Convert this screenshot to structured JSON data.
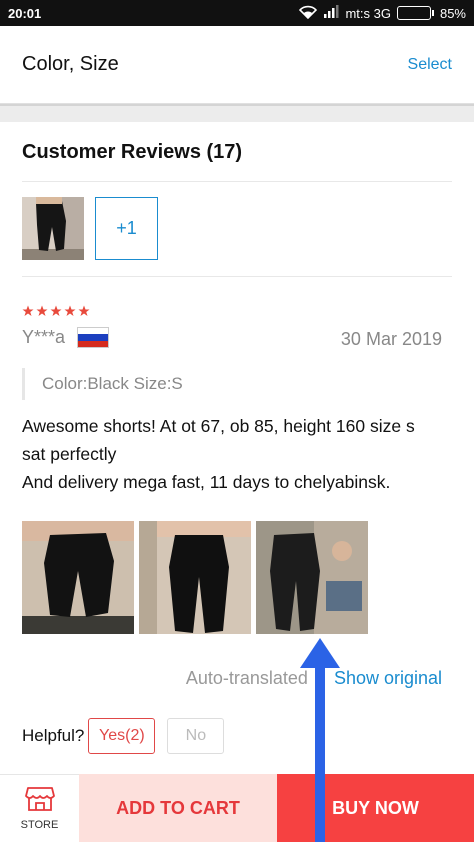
{
  "status_bar": {
    "time": "20:01",
    "carrier": "mt:s 3G",
    "battery": "85%",
    "battery_level": 0.85
  },
  "variant_row": {
    "label": "Color, Size",
    "action": "Select"
  },
  "reviews": {
    "title": "Customer Reviews (17)",
    "more_photos": "+1",
    "review": {
      "rating": 5,
      "reviewer": "Y***a",
      "country_flag": "flag-russia-icon",
      "date": "30 Mar 2019",
      "attributes": "Color:Black Size:S",
      "text_line1": "Awesome shorts! At ot 67, ob 85, height 160 size s",
      "text_line2": "sat perfectly",
      "text_line3": "And delivery mega fast, 11 days to chelyabinsk.",
      "auto_translated": "Auto-translated",
      "show_original": "Show original",
      "helpful_label": "Helpful?",
      "yes_label": "Yes(2)",
      "no_label": "No"
    }
  },
  "bottom_bar": {
    "store_label": "STORE",
    "add_to_cart": "ADD TO CART",
    "buy_now": "BUY NOW"
  },
  "colors": {
    "accent_blue": "#1a8ccf",
    "red": "#f64141",
    "add_cart_bg": "#fde0dc",
    "star": "#e84a3c",
    "annotation_arrow": "#2b63e6"
  }
}
